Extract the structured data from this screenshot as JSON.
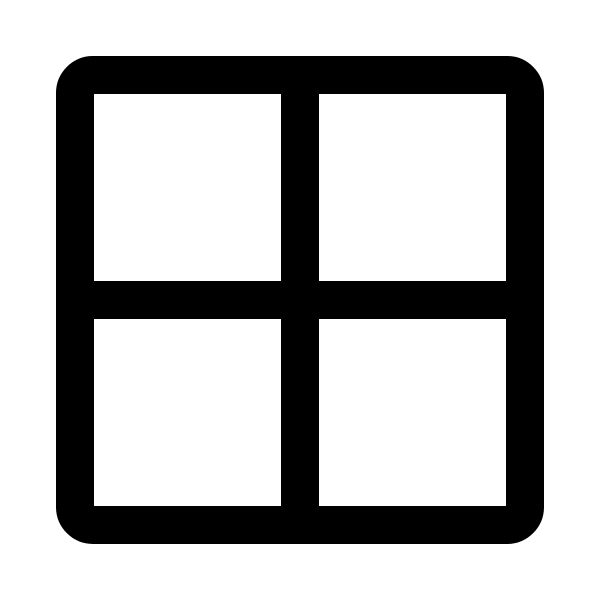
{
  "icon": {
    "name": "grid-icon",
    "stroke_color": "#000000",
    "background_color": "#ffffff"
  }
}
